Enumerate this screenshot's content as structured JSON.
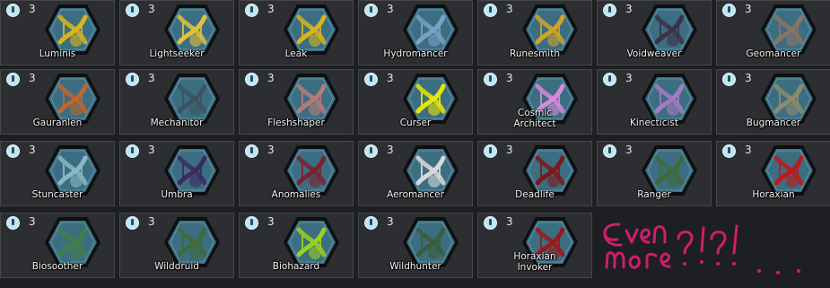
{
  "cost_icon": "power-icon",
  "colors": {
    "cell_bg": "#2c2e31",
    "hex_fill": "#3c6e82",
    "hex_border": "#0d0f10",
    "note_ink": "#cf1d6e"
  },
  "cards": [
    {
      "label": "Luminis",
      "cost": "3",
      "helix": "#d9b51b",
      "emblem": "star"
    },
    {
      "label": "Lightseeker",
      "cost": "3",
      "helix": "#e0c23a",
      "emblem": "burst"
    },
    {
      "label": "Leak",
      "cost": "3",
      "helix": "#d8b41f",
      "emblem": "drop"
    },
    {
      "label": "Hydromancer",
      "cost": "3",
      "helix": "#7aa0c4",
      "emblem": "wave"
    },
    {
      "label": "Runesmith",
      "cost": "3",
      "helix": "#d1a424",
      "emblem": "rune"
    },
    {
      "label": "Voidweaver",
      "cost": "3",
      "helix": "#3e3147",
      "emblem": "claw"
    },
    {
      "label": "Geomancer",
      "cost": "3",
      "helix": "#8a7466",
      "emblem": "rock"
    },
    {
      "label": "Gauranlen",
      "cost": "3",
      "helix": "#c0662d",
      "emblem": "leaf"
    },
    {
      "label": "Mechanitor",
      "cost": "3",
      "helix": "#3a5560",
      "emblem": "gear"
    },
    {
      "label": "Fleshshaper",
      "cost": "3",
      "helix": "#b77a7a",
      "emblem": "flesh"
    },
    {
      "label": "Curser",
      "cost": "3",
      "helix": "#e6e600",
      "emblem": "blood"
    },
    {
      "label": "Cosmic Architect",
      "cost": "3",
      "helix": "#d98ad9",
      "emblem": "star"
    },
    {
      "label": "Kinecticist",
      "cost": "3",
      "helix": "#a27bc0",
      "emblem": "orb"
    },
    {
      "label": "Bugmancer",
      "cost": "3",
      "helix": "#8c8c6a",
      "emblem": "bug"
    },
    {
      "label": "Stuncaster",
      "cost": "3",
      "helix": "#8ab7c7",
      "emblem": "gear"
    },
    {
      "label": "Umbra",
      "cost": "3",
      "helix": "#3c2a5f",
      "emblem": "ring"
    },
    {
      "label": "Anomalies",
      "cost": "3",
      "helix": "#7b2230",
      "emblem": "vine"
    },
    {
      "label": "Aeromancer",
      "cost": "3",
      "helix": "#d9d9d9",
      "emblem": "rock"
    },
    {
      "label": "Deadlife",
      "cost": "3",
      "helix": "#7a1a1a",
      "emblem": "skull"
    },
    {
      "label": "Ranger",
      "cost": "3",
      "helix": "#3e6b3a",
      "emblem": "burst"
    },
    {
      "label": "Horaxian",
      "cost": "3",
      "helix": "#c01818",
      "emblem": "claw"
    },
    {
      "label": "Biosoother",
      "cost": "3",
      "helix": "#3f7f4a",
      "emblem": "leaf"
    },
    {
      "label": "Wilddruid",
      "cost": "3",
      "helix": "#3f6b3a",
      "emblem": "skull"
    },
    {
      "label": "Biohazard",
      "cost": "3",
      "helix": "#9ad11d",
      "emblem": "orb"
    },
    {
      "label": "Wildhunter",
      "cost": "3",
      "helix": "#3a5e3a",
      "emblem": "moon"
    },
    {
      "label": "Horaxian Invoker",
      "cost": "3",
      "helix": "#9a1919",
      "emblem": "skull"
    }
  ],
  "note": {
    "line1": "Even",
    "line2": "more",
    "marks": "?!?!",
    "dots": ". . ."
  }
}
